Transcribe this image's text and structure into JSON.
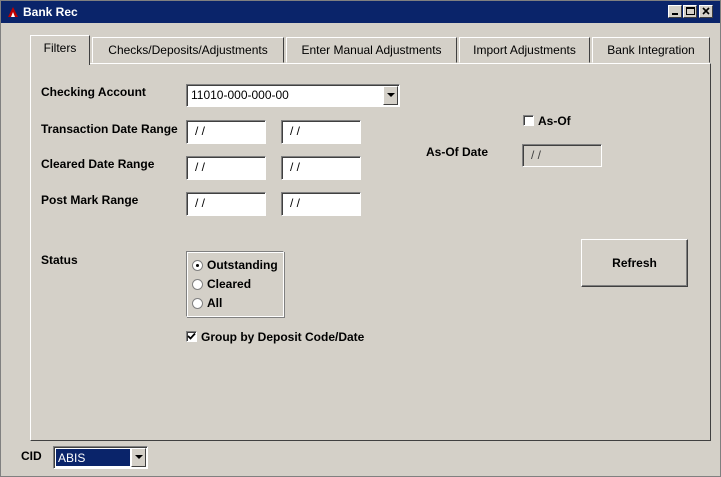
{
  "window": {
    "title": "Bank Rec"
  },
  "tabs": [
    {
      "label": "Filters"
    },
    {
      "label": "Checks/Deposits/Adjustments"
    },
    {
      "label": "Enter Manual Adjustments"
    },
    {
      "label": "Import Adjustments"
    },
    {
      "label": "Bank Integration"
    }
  ],
  "filters": {
    "checking_account_label": "Checking Account",
    "checking_account_value": "11010-000-000-00",
    "transaction_date_label": "Transaction Date Range",
    "transaction_date_from": "/ /",
    "transaction_date_to": "/ /",
    "cleared_date_label": "Cleared Date Range",
    "cleared_date_from": "/ /",
    "cleared_date_to": "/ /",
    "post_mark_label": "Post Mark Range",
    "post_mark_from": "/ /",
    "post_mark_to": "/ /",
    "as_of_label": "As-Of",
    "as_of_checked": false,
    "as_of_date_label": "As-Of Date",
    "as_of_date_value": "/ /",
    "status_label": "Status",
    "status_options": [
      "Outstanding",
      "Cleared",
      "All"
    ],
    "status_selected": "Outstanding",
    "group_by_label": "Group by Deposit Code/Date",
    "group_by_checked": true,
    "refresh_label": "Refresh"
  },
  "footer": {
    "cid_label": "CID",
    "cid_value": "ABIS"
  },
  "colors": {
    "titlebar": "#0a246a",
    "face": "#d4d0c8",
    "selection": "#0a246a"
  }
}
